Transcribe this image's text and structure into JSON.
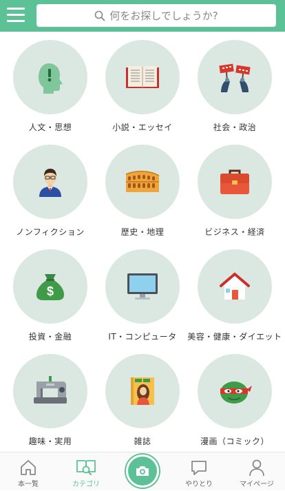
{
  "header": {
    "search_placeholder": "何をお探しでしょうか?"
  },
  "categories": [
    {
      "label": "人文・思想",
      "icon": "head-icon"
    },
    {
      "label": "小説・エッセイ",
      "icon": "book-icon"
    },
    {
      "label": "社会・政治",
      "icon": "protest-signs-icon"
    },
    {
      "label": "ノンフィクション",
      "icon": "businessman-icon"
    },
    {
      "label": "歴史・地理",
      "icon": "colosseum-icon"
    },
    {
      "label": "ビジネス・経済",
      "icon": "briefcase-icon"
    },
    {
      "label": "投資・金融",
      "icon": "money-bag-icon"
    },
    {
      "label": "IT・コンピュータ",
      "icon": "monitor-icon"
    },
    {
      "label": "美容・健康・ダイエット",
      "icon": "house-icon"
    },
    {
      "label": "趣味・実用",
      "icon": "sewing-machine-icon"
    },
    {
      "label": "雑誌",
      "icon": "magazine-icon"
    },
    {
      "label": "漫画（コミック）",
      "icon": "ninja-turtle-icon"
    }
  ],
  "tabbar": {
    "home_label": "本一覧",
    "category_label": "カテゴリ",
    "exchange_label": "やりとり",
    "mypage_label": "マイページ"
  },
  "colors": {
    "brand": "#5cc196",
    "circle_bg": "#dbe7e1"
  }
}
